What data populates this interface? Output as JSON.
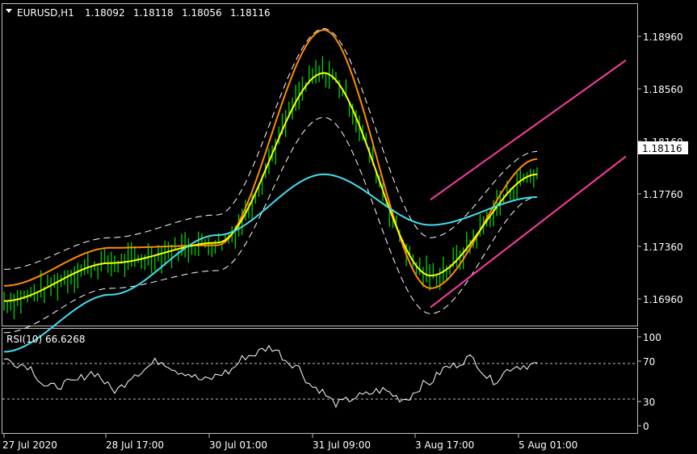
{
  "header": {
    "symbol": "EURUSD,H1",
    "ohlc": [
      "1.18092",
      "1.18118",
      "1.18056",
      "1.18116"
    ],
    "menu_icon": "triangle-down-icon"
  },
  "price_panel": {
    "current_price_label": "1.18116",
    "current_price_bg": "#ffffff",
    "y_ticks": [
      "1.18960",
      "1.18560",
      "1.18160",
      "1.17760",
      "1.17360",
      "1.16960"
    ]
  },
  "rsi_panel": {
    "label": "RSI(10) 66.6268",
    "levels": [
      "100",
      "70",
      "30",
      "0"
    ]
  },
  "x_ticks": [
    "27 Jul 2020",
    "28 Jul 17:00",
    "30 Jul 01:00",
    "31 Jul 09:00",
    "3 Aug 17:00",
    "5 Aug 01:00"
  ],
  "colors": {
    "background": "#000000",
    "bars": "#00c800",
    "fast_ma": "#ff8c00",
    "mid_ma": "#ffff00",
    "slow_ma": "#40e0f0",
    "bands": "#ffffff",
    "channel": "#ff3ca0",
    "rsi_line": "#ffffff"
  },
  "chart_data": {
    "type": "line",
    "title": "EURUSD,H1",
    "ylim": [
      1.168,
      1.1935
    ],
    "x": [
      "27 Jul 2020",
      "28 Jul 17:00",
      "30 Jul 01:00",
      "31 Jul 09:00",
      "3 Aug 17:00",
      "5 Aug 01:00"
    ],
    "series": [
      {
        "values": [
          1.1712,
          1.1742,
          1.1744,
          1.1914,
          1.171,
          1.1812
        ]
      },
      {
        "values": [
          1.17,
          1.173,
          1.1746,
          1.188,
          1.172,
          1.18
        ]
      },
      {
        "values": [
          1.166,
          1.1705,
          1.1752,
          1.18,
          1.176,
          1.1782
        ]
      }
    ],
    "channel": {
      "upper": [
        [
          1.178,
          "3 Aug 17:00"
        ],
        [
          1.184,
          "5 Aug 01:00"
        ]
      ],
      "lower": [
        [
          1.1695,
          "3 Aug 17:00"
        ],
        [
          1.176,
          "5 Aug 01:00"
        ]
      ]
    },
    "rsi": {
      "period": 10,
      "last": 66.6268,
      "levels": [
        70,
        30
      ],
      "values": [
        74,
        68,
        43,
        48,
        60,
        40,
        60,
        73,
        61,
        51,
        60,
        79,
        88,
        70,
        43,
        25,
        33,
        40,
        30,
        47,
        66,
        76,
        51,
        67,
        69
      ]
    }
  }
}
